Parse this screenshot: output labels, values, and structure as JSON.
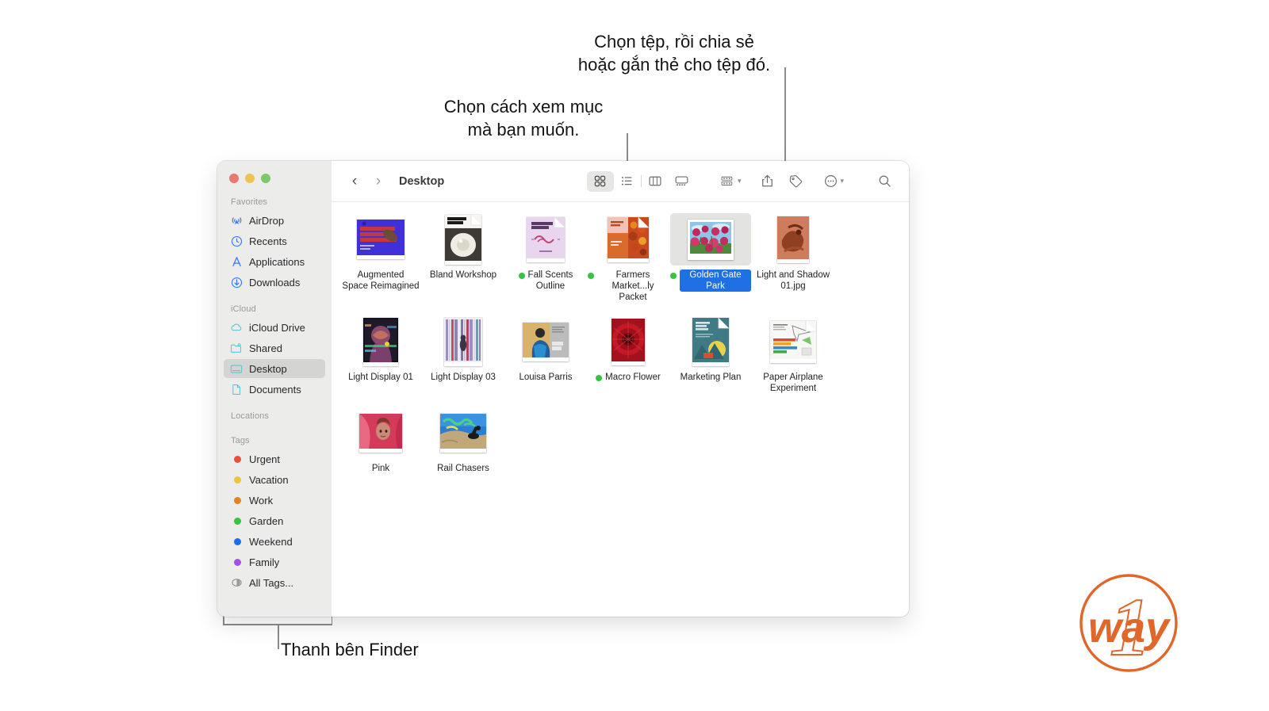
{
  "annotations": {
    "top_right": "Chọn tệp, rồi chia sẻ\nhoặc gắn thẻ cho tệp đó.",
    "top_left": "Chọn cách xem mục\nmà bạn muốn.",
    "bottom_left": "Thanh bên Finder"
  },
  "window": {
    "traffic_lights": [
      "close-button",
      "minimize-button",
      "zoom-button"
    ],
    "colors": {
      "close": "#e8796f",
      "minimize": "#eec254",
      "zoom": "#7bc96a"
    }
  },
  "toolbar": {
    "back_label": "‹",
    "forward_label": "›",
    "breadcrumb": "Desktop",
    "view_buttons": [
      {
        "name": "icon-view-button",
        "label": "Xem dạng biểu tượng",
        "active": true
      },
      {
        "name": "list-view-button",
        "label": "Xem dạng danh sách",
        "active": false
      },
      {
        "name": "column-view-button",
        "label": "Xem dạng cột",
        "active": false
      },
      {
        "name": "gallery-view-button",
        "label": "Xem dạng bộ sưu tập",
        "active": false
      }
    ],
    "group_by_label": "Nhóm",
    "share_label": "Chia sẻ",
    "tag_label": "Thẻ",
    "more_label": "Thêm",
    "search_label": "Tìm kiếm"
  },
  "sidebar": {
    "groups": [
      {
        "title": "Favorites",
        "items": [
          {
            "label": "AirDrop",
            "icon": "airdrop-icon",
            "color": "#3478f6",
            "selected": false
          },
          {
            "label": "Recents",
            "icon": "clock-icon",
            "color": "#3478f6",
            "selected": false
          },
          {
            "label": "Applications",
            "icon": "applications-icon",
            "color": "#3478f6",
            "selected": false
          },
          {
            "label": "Downloads",
            "icon": "download-icon",
            "color": "#3478f6",
            "selected": false
          }
        ]
      },
      {
        "title": "iCloud",
        "items": [
          {
            "label": "iCloud Drive",
            "icon": "cloud-icon",
            "color": "#5ac8d8",
            "selected": false
          },
          {
            "label": "Shared",
            "icon": "shared-folder-icon",
            "color": "#5ac8d8",
            "selected": false
          },
          {
            "label": "Desktop",
            "icon": "desktop-icon",
            "color": "#5ac8d8",
            "selected": true
          },
          {
            "label": "Documents",
            "icon": "document-icon",
            "color": "#5ac8d8",
            "selected": false
          }
        ]
      },
      {
        "title": "Locations",
        "items": []
      },
      {
        "title": "Tags",
        "items": [
          {
            "label": "Urgent",
            "icon": "tag-dot-icon",
            "color": "#eb4d3d",
            "selected": false
          },
          {
            "label": "Vacation",
            "icon": "tag-dot-icon",
            "color": "#ecc33c",
            "selected": false
          },
          {
            "label": "Work",
            "icon": "tag-dot-icon",
            "color": "#e08424",
            "selected": false
          },
          {
            "label": "Garden",
            "icon": "tag-dot-icon",
            "color": "#34c540",
            "selected": false
          },
          {
            "label": "Weekend",
            "icon": "tag-dot-icon",
            "color": "#176df5",
            "selected": false
          },
          {
            "label": "Family",
            "icon": "tag-dot-icon",
            "color": "#a451e0",
            "selected": false
          },
          {
            "label": "All Tags...",
            "icon": "all-tags-icon",
            "color": "#8c8c8c",
            "selected": false
          }
        ]
      }
    ]
  },
  "files": [
    {
      "name": "Augmented\nSpace Reimagined",
      "tag_color": null,
      "selected": false,
      "thumb": "augmented-space"
    },
    {
      "name": "Bland Workshop",
      "tag_color": null,
      "selected": false,
      "thumb": "bland-workshop"
    },
    {
      "name": "Fall Scents\nOutline",
      "tag_color": "#34c540",
      "selected": false,
      "thumb": "fall-scents"
    },
    {
      "name": "Farmers\nMarket...ly Packet",
      "tag_color": "#34c540",
      "selected": false,
      "thumb": "farmers-market"
    },
    {
      "name": "Golden Gate Park",
      "tag_color": "#34c540",
      "selected": true,
      "thumb": "golden-gate"
    },
    {
      "name": "Light and Shadow\n01.jpg",
      "tag_color": null,
      "selected": false,
      "thumb": "light-shadow"
    },
    {
      "name": "Light Display 01",
      "tag_color": null,
      "selected": false,
      "thumb": "light-display-01"
    },
    {
      "name": "Light Display 03",
      "tag_color": null,
      "selected": false,
      "thumb": "light-display-03"
    },
    {
      "name": "Louisa Parris",
      "tag_color": null,
      "selected": false,
      "thumb": "louisa-parris"
    },
    {
      "name": "Macro Flower",
      "tag_color": "#34c540",
      "selected": false,
      "thumb": "macro-flower"
    },
    {
      "name": "Marketing Plan",
      "tag_color": null,
      "selected": false,
      "thumb": "marketing-plan"
    },
    {
      "name": "Paper Airplane\nExperiment",
      "tag_color": null,
      "selected": false,
      "thumb": "paper-airplane"
    },
    {
      "name": "Pink",
      "tag_color": null,
      "selected": false,
      "thumb": "pink"
    },
    {
      "name": "Rail Chasers",
      "tag_color": null,
      "selected": false,
      "thumb": "rail-chasers"
    }
  ],
  "watermark": {
    "text": "way",
    "numeral": "1",
    "color": "#e0662a"
  }
}
